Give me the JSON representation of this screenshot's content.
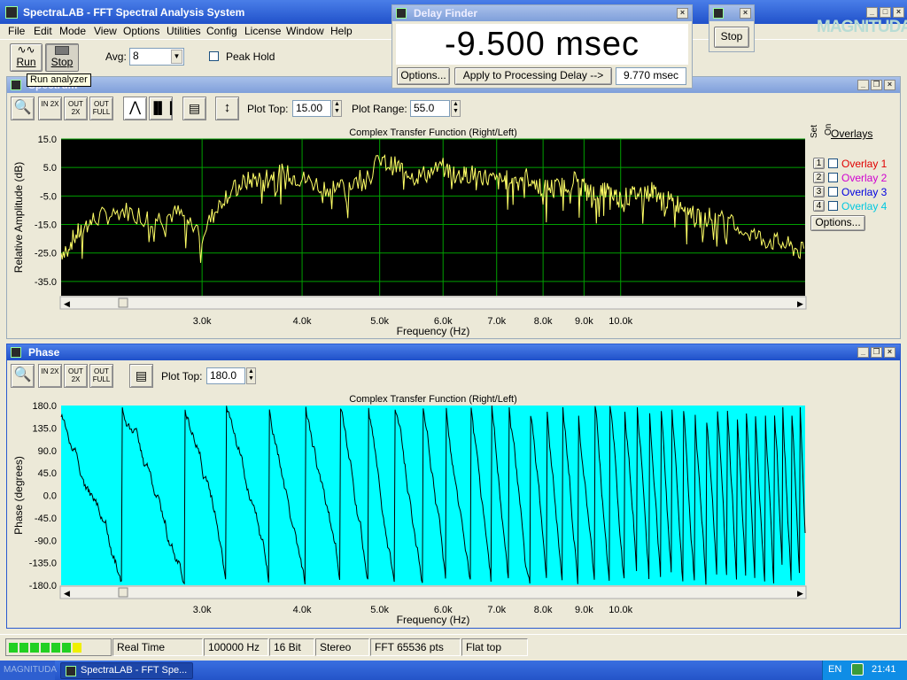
{
  "app": {
    "title": "SpectraLAB - FFT Spectral Analysis System"
  },
  "menu": [
    "File",
    "Edit",
    "Mode",
    "View",
    "Options",
    "Utilities",
    "Config",
    "License",
    "Window",
    "Help"
  ],
  "toolbar": {
    "run_label": "Run",
    "stop_label": "Stop",
    "avg_label": "Avg:",
    "avg_value": "8",
    "peak_hold_label": "Peak Hold",
    "tooltip": "Run analyzer"
  },
  "delay_finder": {
    "title": "Delay Finder",
    "value": "-9.500 msec",
    "options_label": "Options...",
    "apply_label": "Apply to Processing Delay -->",
    "processing_delay": "9.770 msec"
  },
  "stop_window": {
    "label": "Stop"
  },
  "watermark": "MAGNITUDA",
  "spectrum": {
    "window_title": "Spectrum",
    "plot_top_label": "Plot Top:",
    "plot_top_value": "15.00",
    "plot_range_label": "Plot Range:",
    "plot_range_value": "55.0",
    "zoom_in": "IN 2X",
    "zoom_out": "OUT 2X",
    "zoom_full": "OUT FULL"
  },
  "phase": {
    "window_title": "Phase",
    "plot_top_label": "Plot Top:",
    "plot_top_value": "180.0",
    "zoom_in": "IN 2X",
    "zoom_out": "OUT 2X",
    "zoom_full": "OUT FULL"
  },
  "overlays": {
    "title": "Overlays",
    "set_label": "Set",
    "on_label": "On",
    "options_label": "Options...",
    "items": [
      {
        "num": "1",
        "label": "Overlay 1",
        "color": "#e00000"
      },
      {
        "num": "2",
        "label": "Overlay 2",
        "color": "#d000d0"
      },
      {
        "num": "3",
        "label": "Overlay 3",
        "color": "#0000e0"
      },
      {
        "num": "4",
        "label": "Overlay 4",
        "color": "#00c8e0"
      }
    ]
  },
  "status": {
    "mode": "Real Time",
    "rate": "100000 Hz",
    "bits": "16 Bit",
    "channels": "Stereo",
    "fft": "FFT 65536 pts",
    "window": "Flat top"
  },
  "taskbar": {
    "task_label": "SpectraLAB - FFT Spe...",
    "lang": "EN",
    "time": "21:41",
    "start_text": "MAGNITUDA"
  },
  "chart_data": [
    {
      "type": "line",
      "title": "Complex Transfer Function (Right/Left)",
      "xlabel": "Frequency (Hz)",
      "ylabel": "Relative Amplitude (dB)",
      "ylim": [
        -40,
        15
      ],
      "yticks": [
        "15.0",
        "5.0",
        "-5.0",
        "-15.0",
        "-25.0",
        "-35.0"
      ],
      "xticks": [
        "3.0k",
        "4.0k",
        "5.0k",
        "6.0k",
        "7.0k",
        "8.0k",
        "9.0k",
        "10.0k"
      ],
      "xscale": "log",
      "background": "#000000",
      "line_color": "#ffff66",
      "grid_color": "#00a000",
      "grid": true,
      "x": [
        2000,
        2100,
        2200,
        2400,
        2600,
        2800,
        3000,
        3200,
        3400,
        3600,
        3800,
        4000,
        4300,
        4600,
        5000,
        5300,
        5600,
        6000,
        6300,
        6600,
        7000,
        7300,
        7600,
        8000,
        8400,
        8800,
        9200,
        9600,
        10000,
        10500,
        11000,
        11500,
        12000,
        12500,
        13000,
        14000,
        15000,
        16000,
        17000
      ],
      "values": [
        -25,
        -18,
        -13,
        -10,
        -13,
        -11,
        -18,
        -5,
        0,
        2,
        3,
        1,
        -2,
        -1,
        7,
        5,
        2,
        5,
        2,
        3,
        0,
        1,
        2,
        -2,
        -2,
        1,
        -4,
        -3,
        -6,
        -4,
        -3,
        -7,
        -8,
        -13,
        -12,
        -16,
        -20,
        -22,
        -25
      ]
    },
    {
      "type": "line",
      "title": "Complex Transfer Function (Right/Left)",
      "xlabel": "Frequency (Hz)",
      "ylabel": "Phase (degrees)",
      "ylim": [
        -180,
        180
      ],
      "yticks": [
        "180.0",
        "135.0",
        "90.0",
        "45.0",
        "0.0",
        "-45.0",
        "-90.0",
        "-135.0",
        "-180.0"
      ],
      "xticks": [
        "3.0k",
        "4.0k",
        "5.0k",
        "6.0k",
        "7.0k",
        "8.0k",
        "9.0k",
        "10.0k"
      ],
      "xscale": "log",
      "background": "#00ffff",
      "line_color": "#000000",
      "grid": false
    }
  ]
}
